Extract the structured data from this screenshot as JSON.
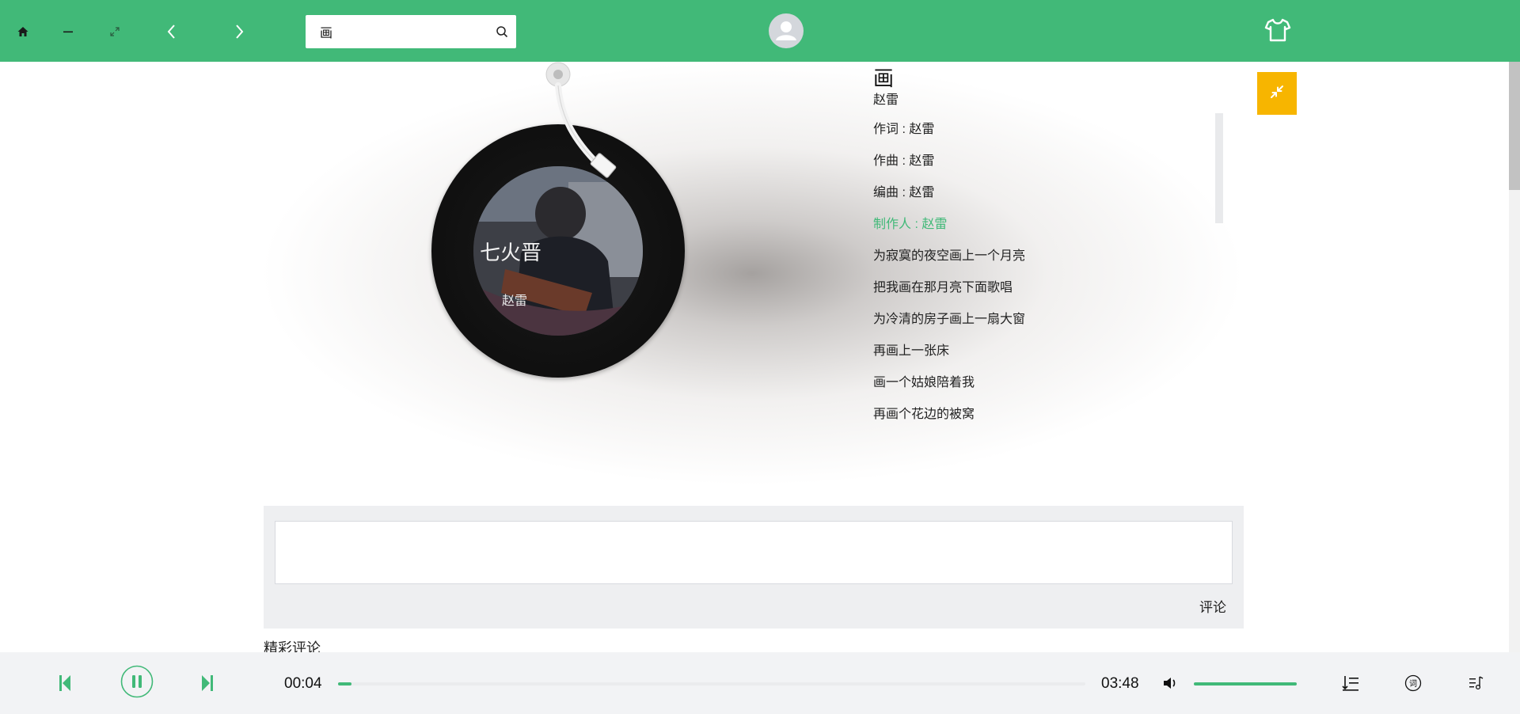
{
  "topbar": {
    "search": {
      "value": "画",
      "placeholder": ""
    },
    "icons": {
      "home": "home-icon",
      "minimize": "minimize-icon",
      "expand": "expand-icon",
      "back": "chevron-left-icon",
      "forward": "chevron-right-icon",
      "search": "search-icon",
      "avatar": "user-avatar-icon",
      "skin": "tshirt-icon"
    },
    "accent_color": "#41b978"
  },
  "song": {
    "title": "画",
    "artist": "赵雷"
  },
  "lyrics": [
    {
      "text": "作词 : 赵雷",
      "active": false
    },
    {
      "text": "作曲 : 赵雷",
      "active": false
    },
    {
      "text": "编曲 : 赵雷",
      "active": false
    },
    {
      "text": "制作人 : 赵雷",
      "active": true
    },
    {
      "text": "为寂寞的夜空画上一个月亮",
      "active": false
    },
    {
      "text": "把我画在那月亮下面歌唱",
      "active": false
    },
    {
      "text": "为冷清的房子画上一扇大窗",
      "active": false
    },
    {
      "text": "再画上一张床",
      "active": false
    },
    {
      "text": "画一个姑娘陪着我",
      "active": false
    },
    {
      "text": "再画个花边的被窝",
      "active": false
    }
  ],
  "restore_button": {
    "icon": "compress-icon",
    "color": "#f7b500"
  },
  "comments": {
    "submit_label": "评论",
    "input_value": "",
    "hot_title": "精彩评论"
  },
  "player": {
    "current_time": "00:04",
    "total_time": "03:48",
    "progress_fraction": 0.018,
    "volume_fraction": 1.0,
    "icons": {
      "prev": "skip-previous-icon",
      "pause": "pause-icon",
      "next": "skip-next-icon",
      "volume": "volume-icon",
      "playlist": "playlist-icon",
      "lyrics": "lyrics-icon",
      "playmode": "music-list-icon"
    }
  }
}
